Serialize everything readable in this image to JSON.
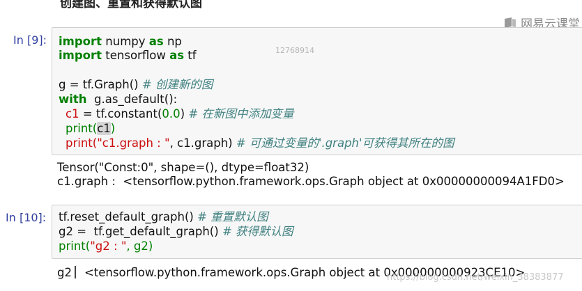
{
  "heading": "创建图、重置和获得默认图",
  "watermark": {
    "icon": "brand-logo-icon",
    "text": "网易云课堂"
  },
  "cell1": {
    "prompt": "In [9]:",
    "faint_text": "12768914",
    "lines": {
      "l1": {
        "kw1": "import",
        "t1": " numpy ",
        "kw2": "as",
        "t2": " np"
      },
      "l2": {
        "kw1": "import",
        "t1": " tensorflow ",
        "kw2": "as",
        "t2": " tf"
      },
      "l3": {
        "t1": "g = tf.Graph() ",
        "comment": "# 创建新的图"
      },
      "l4": {
        "kw1": "with",
        "t1": "  g.as_default():"
      },
      "l5": {
        "v1": "c1",
        "t1": " = tf.constant(",
        "num": "0.0",
        "t2": ") ",
        "comment": "# 在新图中添加变量"
      },
      "l6": {
        "fn": "print(",
        "hl": "c1",
        "t1": ")"
      },
      "l7": {
        "fn": "print(",
        "str": "\"c1.graph : \"",
        "t1": ", c1.graph) ",
        "comment": "# 可通过变量的'.graph'可获得其所在的图"
      }
    },
    "output": [
      "Tensor(\"Const:0\", shape=(), dtype=float32)",
      "c1.graph :  <tensorflow.python.framework.ops.Graph object at 0x00000000094A1FD0>"
    ]
  },
  "cell2": {
    "prompt": "In [10]:",
    "lines": {
      "l1": {
        "t1": "tf.reset_default_graph() ",
        "comment": "# 重置默认图"
      },
      "l2": {
        "t1": "g2 =  tf.get_default_graph() ",
        "comment": "# 获得默认图"
      },
      "l3": {
        "fn": "print(",
        "str": "\"g2 : \"",
        "t1": ", g2)"
      }
    },
    "output_prefix": "g2",
    "output_rest": "<tensorflow.python.framework.ops.Graph object at 0x000000000923CE10>"
  },
  "url_watermark": "https://blog.csdn.net/weixin_38383877"
}
